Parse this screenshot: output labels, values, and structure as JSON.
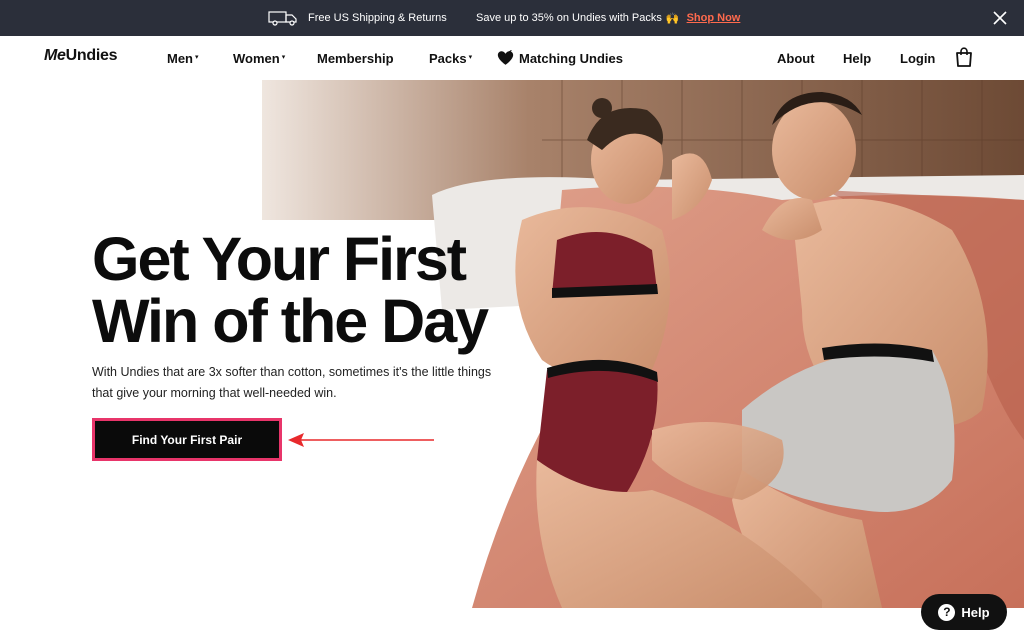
{
  "promo": {
    "shipping_text": "Free US Shipping & Returns",
    "save_text": "Save up to 35% on Undies with Packs",
    "save_emoji": "🙌",
    "shop_link": "Shop Now",
    "icons": [
      "truck-icon",
      "close-icon"
    ]
  },
  "nav": {
    "logo_part1": "Me",
    "logo_part2": "Undies",
    "items": [
      {
        "label": "Men",
        "dropdown": true
      },
      {
        "label": "Women",
        "dropdown": true
      },
      {
        "label": "Membership",
        "dropdown": false
      },
      {
        "label": "Packs",
        "dropdown": true
      },
      {
        "label": "Matching Undies",
        "dropdown": false,
        "icon": "heart-icon"
      }
    ],
    "caret": "▾",
    "right": [
      {
        "label": "About"
      },
      {
        "label": "Help"
      },
      {
        "label": "Login"
      }
    ],
    "cart_icon": "shopping-bag-icon"
  },
  "hero": {
    "headline_line1": "Get Your First",
    "headline_line2": "Win of the Day",
    "subtext": "With Undies that are 3x softer than cotton, sometimes it's the little things that give your morning that well-needed win.",
    "cta_label": "Find Your First Pair"
  },
  "help_widget": {
    "label": "Help",
    "icon": "?"
  },
  "colors": {
    "promo_bg": "#2b2f3a",
    "accent_link": "#ff6a4d",
    "cta_bg": "#0a0a0a",
    "cta_border": "#e8356a",
    "annotation_arrow": "#e8292c"
  }
}
